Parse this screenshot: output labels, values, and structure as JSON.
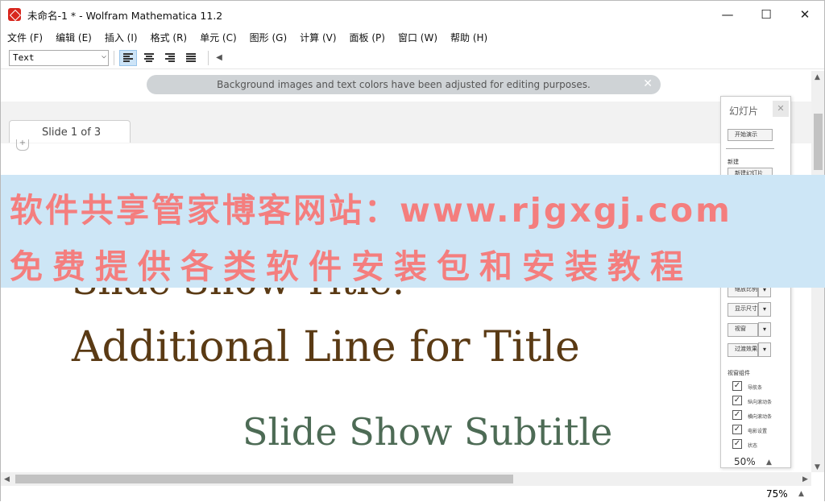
{
  "window": {
    "title": "未命名-1 * - Wolfram Mathematica 11.2"
  },
  "window_buttons": {
    "minimize": "—",
    "maximize": "☐",
    "close": "✕"
  },
  "menu": [
    "文件 (F)",
    "编辑 (E)",
    "插入 (I)",
    "格式 (R)",
    "单元 (C)",
    "图形 (G)",
    "计算 (V)",
    "面板 (P)",
    "窗口 (W)",
    "帮助 (H)"
  ],
  "toolbar": {
    "style_value": "Text"
  },
  "notice": {
    "text": "Background images and text colors have been adjusted for editing purposes.",
    "close": "✕"
  },
  "slide_tab": {
    "label": "Slide 1 of 3"
  },
  "slide": {
    "title_line1": "Slide Show Title:",
    "title_line2": "Additional Line for Title",
    "subtitle": "Slide Show Subtitle"
  },
  "status": {
    "zoom": "75%"
  },
  "palette": {
    "title": "幻灯片",
    "start_button": "开始演示",
    "section_new": "新建",
    "new_slide_button": "新建幻灯片",
    "buttons": [
      "缩放比例",
      "显示尺寸",
      "视窗",
      "过渡效果"
    ],
    "section_toolbar": "视窗组件",
    "checks": [
      "导航条",
      "纵向滚动条",
      "横向滚动条",
      "电影设置",
      "状态"
    ],
    "zoom": "50%"
  },
  "watermark": {
    "line1": "软件共享管家博客网站：www.rjgxgj.com",
    "line2": "免费提供各类软件安装包和安装教程"
  },
  "colors": {
    "title_text": "#5a3a14",
    "subtitle_text": "#4d6b55",
    "watermark_text": "#f47e7e",
    "watermark_bg": "#cde6f6"
  }
}
